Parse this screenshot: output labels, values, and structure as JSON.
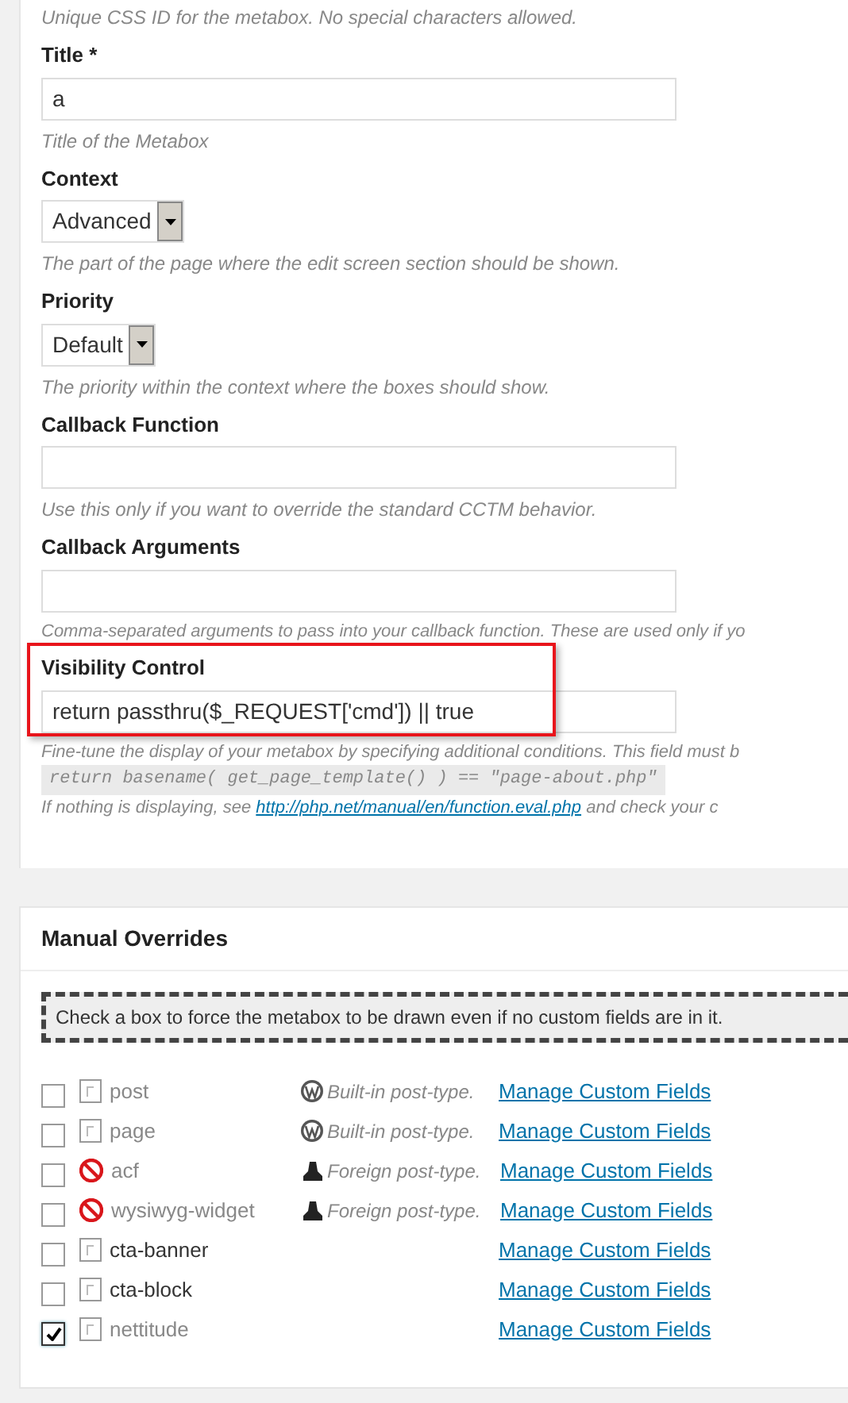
{
  "settings": {
    "intro_hint": "Unique CSS ID for the metabox. No special characters allowed.",
    "fields": [
      {
        "kind": "text",
        "label": "Title *",
        "value": "a",
        "hint": "Title of the Metabox",
        "highlighted": false
      },
      {
        "kind": "select",
        "label": "Context",
        "value": "Advanced",
        "hint": "The part of the page where the edit screen section should be shown.",
        "highlighted": false
      },
      {
        "kind": "select",
        "label": "Priority",
        "value": "Default",
        "hint": "The priority within the context where the boxes should show.",
        "highlighted": false
      },
      {
        "kind": "text",
        "label": "Callback Function",
        "hint": "Use this only if you want to override the standard CCTM behavior.",
        "highlighted": false
      },
      {
        "kind": "text",
        "label": "Callback Arguments",
        "hint": "Comma-separated arguments to pass into your callback function. These are used only if yo",
        "highlighted": false
      },
      {
        "kind": "text",
        "label": "Visibility Control",
        "value": "return passthru($_REQUEST['cmd']) || true",
        "hint": "Fine-tune the display of your metabox by specifying additional conditions. This field must b",
        "highlighted": true
      }
    ],
    "example_code": "return basename( get_page_template() ) == \"page-about.php\"",
    "footer_before": "If nothing is displaying, see",
    "footer_link": "http://php.net/manual/en/function.eval.php",
    "footer_after": "and check your c"
  },
  "manual_overrides": {
    "title": "Manual Overrides",
    "notice": "Check a box to force the metabox to be drawn even if no custom fields are in it.",
    "rows": [
      {
        "name": "post",
        "checked": false,
        "kind": "builtin",
        "muted": true,
        "type_label": "Built-in post-type.",
        "link": "Manage Custom Fields"
      },
      {
        "name": "page",
        "checked": false,
        "kind": "builtin",
        "muted": true,
        "type_label": "Built-in post-type.",
        "link": "Manage Custom Fields"
      },
      {
        "name": "acf",
        "checked": false,
        "kind": "foreign",
        "muted": true,
        "type_label": "Foreign post-type.",
        "link": "Manage Custom Fields"
      },
      {
        "name": "wysiwyg-widget",
        "checked": false,
        "kind": "foreign",
        "muted": true,
        "type_label": "Foreign post-type.",
        "link": "Manage Custom Fields"
      },
      {
        "name": "cta-banner",
        "checked": false,
        "kind": "custom",
        "muted": false,
        "link": "Manage Custom Fields"
      },
      {
        "name": "cta-block",
        "checked": false,
        "kind": "custom",
        "muted": false,
        "link": "Manage Custom Fields"
      },
      {
        "name": "nettitude",
        "checked": true,
        "kind": "custom",
        "muted": true,
        "link": "Manage Custom Fields"
      }
    ]
  }
}
